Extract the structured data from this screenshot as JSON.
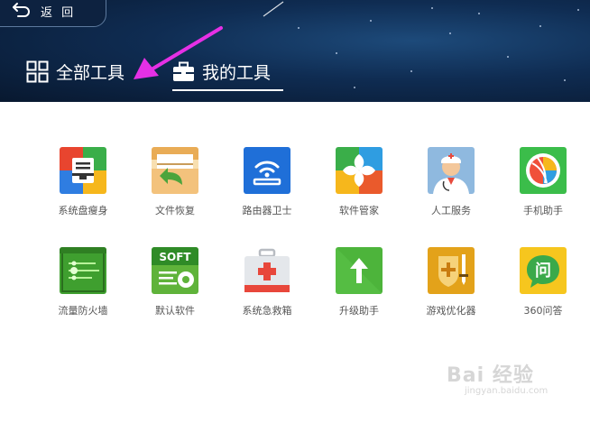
{
  "header": {
    "back_label": "返 回",
    "tabs": [
      {
        "label": "全部工具",
        "icon": "grid-icon"
      },
      {
        "label": "我的工具",
        "icon": "toolbox-icon",
        "active": true
      }
    ]
  },
  "tools": [
    {
      "label": "系统盘瘦身",
      "icon": "disk-slim-icon"
    },
    {
      "label": "文件恢复",
      "icon": "file-recovery-icon"
    },
    {
      "label": "路由器卫士",
      "icon": "router-guard-icon"
    },
    {
      "label": "软件管家",
      "icon": "software-manager-icon"
    },
    {
      "label": "人工服务",
      "icon": "doctor-icon"
    },
    {
      "label": "手机助手",
      "icon": "phone-assistant-icon"
    },
    {
      "label": "流量防火墙",
      "icon": "traffic-firewall-icon"
    },
    {
      "label": "默认软件",
      "icon": "default-software-icon"
    },
    {
      "label": "系统急救箱",
      "icon": "first-aid-kit-icon"
    },
    {
      "label": "升级助手",
      "icon": "upgrade-arrow-icon"
    },
    {
      "label": "游戏优化器",
      "icon": "game-optimizer-icon"
    },
    {
      "label": "360问答",
      "icon": "qa-icon"
    }
  ],
  "watermark": {
    "main": "Bai 经验",
    "sub": "jingyan.baidu.com"
  },
  "colors": {
    "header_dark": "#08182f",
    "header_mid": "#1d4a7a",
    "annotation_arrow": "#e530e5",
    "label_text": "#555555"
  }
}
